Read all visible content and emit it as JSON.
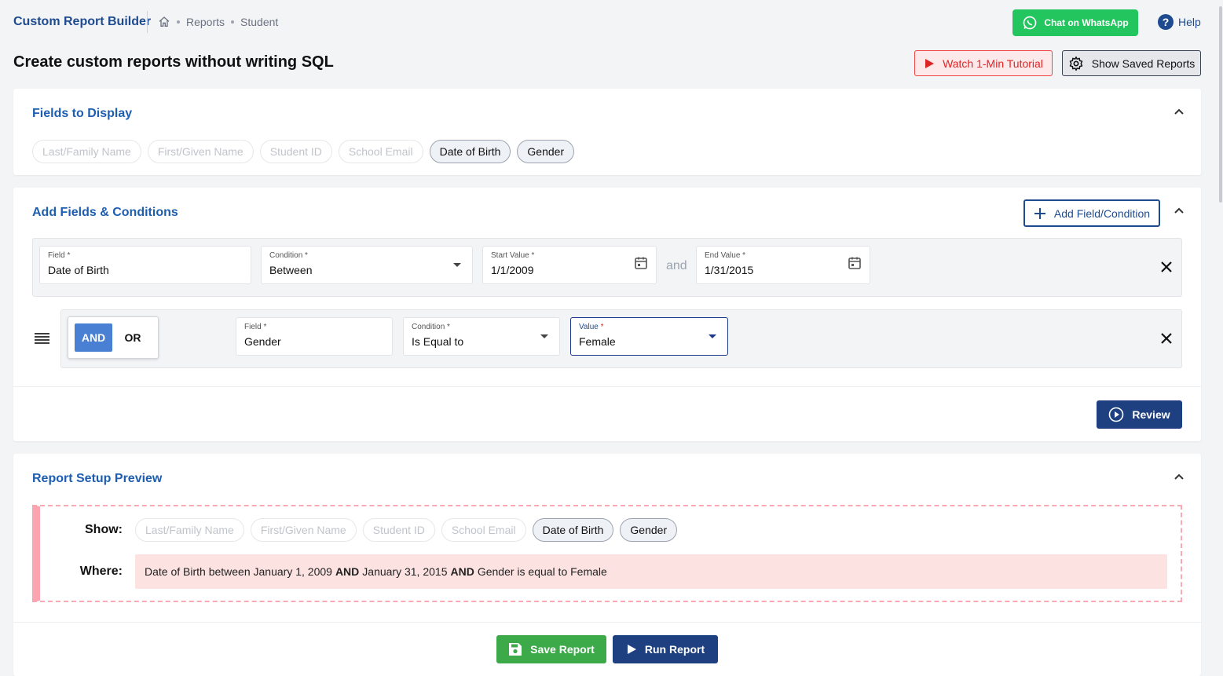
{
  "header": {
    "app_title": "Custom Report Builder",
    "breadcrumb": [
      "Reports",
      "Student"
    ],
    "whatsapp_label": "Chat on WhatsApp",
    "help_label": "Help"
  },
  "page": {
    "title": "Create custom reports without writing SQL",
    "tutorial_label": "Watch 1-Min Tutorial",
    "saved_reports_label": "Show Saved Reports"
  },
  "fields_to_display": {
    "title": "Fields to Display",
    "chips": [
      {
        "label": "Last/Family Name",
        "selected": false
      },
      {
        "label": "First/Given Name",
        "selected": false
      },
      {
        "label": "Student ID",
        "selected": false
      },
      {
        "label": "School Email",
        "selected": false
      },
      {
        "label": "Date of Birth",
        "selected": true
      },
      {
        "label": "Gender",
        "selected": true
      }
    ]
  },
  "conditions": {
    "title": "Add Fields & Conditions",
    "add_label": "Add Field/Condition",
    "row1": {
      "field_label": "Field *",
      "field_value": "Date of Birth",
      "condition_label": "Condition *",
      "condition_value": "Between",
      "start_label": "Start Value *",
      "start_value": "1/1/2009",
      "and_text": "and",
      "end_label": "End Value *",
      "end_value": "1/31/2015"
    },
    "row2": {
      "and_label": "AND",
      "or_label": "OR",
      "field_label": "Field *",
      "field_value": "Gender",
      "condition_label": "Condition *",
      "condition_value": "Is Equal to",
      "value_label": "Value",
      "value_required": "*",
      "value_value": "Female"
    },
    "review_label": "Review"
  },
  "preview": {
    "title": "Report Setup Preview",
    "show_label": "Show:",
    "where_label": "Where:",
    "where_parts": {
      "p1": "Date of Birth between January 1, 2009",
      "op1": "AND",
      "p2": "January 31, 2015",
      "op2": "AND",
      "p3": "Gender is equal to Female"
    }
  },
  "footer": {
    "save_label": "Save Report",
    "run_label": "Run Report"
  },
  "colors": {
    "brand_blue": "#1e4b8f",
    "whatsapp_green": "#22c55e",
    "save_green": "#3daa4a",
    "danger_red": "#dc2626"
  }
}
